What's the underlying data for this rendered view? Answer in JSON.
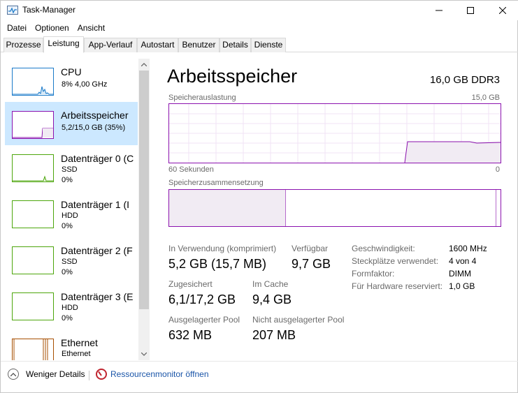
{
  "window": {
    "title": "Task-Manager"
  },
  "menu": [
    "Datei",
    "Optionen",
    "Ansicht"
  ],
  "tabs": [
    "Prozesse",
    "Leistung",
    "App-Verlauf",
    "Autostart",
    "Benutzer",
    "Details",
    "Dienste"
  ],
  "active_tab": "Leistung",
  "sidebar": {
    "items": [
      {
        "name": "CPU",
        "line1": "8%  4,00 GHz",
        "line2": "",
        "color": "#1a7ac9"
      },
      {
        "name": "Arbeitsspeicher",
        "line1": "5,2/15,0 GB (35%)",
        "line2": "",
        "color": "#8b12ae"
      },
      {
        "name": "Datenträger 0 (C",
        "line1": "SSD",
        "line2": "0%",
        "color": "#4da60c"
      },
      {
        "name": "Datenträger 1 (I",
        "line1": "HDD",
        "line2": "0%",
        "color": "#4da60c"
      },
      {
        "name": "Datenträger 2 (F",
        "line1": "SSD",
        "line2": "0%",
        "color": "#4da60c"
      },
      {
        "name": "Datenträger 3 (E",
        "line1": "HDD",
        "line2": "0%",
        "color": "#4da60c"
      },
      {
        "name": "Ethernet",
        "line1": "Ethernet",
        "line2": "",
        "color": "#a74f01"
      }
    ],
    "selected_index": 1
  },
  "main": {
    "title": "Arbeitsspeicher",
    "spec": "16,0 GB DDR3",
    "usage_label": "Speicherauslastung",
    "usage_max": "15,0 GB",
    "time_left": "60 Sekunden",
    "time_right": "0",
    "composition_label": "Speicherzusammensetzung",
    "memory_usage_fraction": 0.35
  },
  "stats": {
    "in_use_label": "In Verwendung (komprimiert)",
    "in_use_value": "5,2 GB (15,7 MB)",
    "available_label": "Verfügbar",
    "available_value": "9,7 GB",
    "committed_label": "Zugesichert",
    "committed_value": "6,1/17,2 GB",
    "cached_label": "Im Cache",
    "cached_value": "9,4 GB",
    "paged_label": "Ausgelagerter Pool",
    "paged_value": "632 MB",
    "nonpaged_label": "Nicht ausgelagerter Pool",
    "nonpaged_value": "207 MB"
  },
  "details": [
    {
      "label": "Geschwindigkeit:",
      "value": "1600 MHz"
    },
    {
      "label": "Steckplätze verwendet:",
      "value": "4 von 4"
    },
    {
      "label": "Formfaktor:",
      "value": "DIMM"
    },
    {
      "label": "Für Hardware reserviert:",
      "value": "1,0 GB"
    }
  ],
  "footer": {
    "fewer_details": "Weniger Details",
    "resource_monitor": "Ressourcenmonitor öffnen"
  }
}
